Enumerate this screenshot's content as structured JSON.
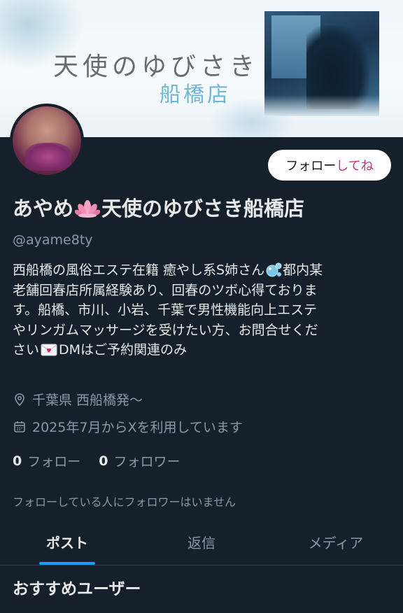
{
  "banner": {
    "title": "天使のゆびさき",
    "subtitle": "船橋店"
  },
  "follow_button": {
    "label_main": "フォロー",
    "label_accent": "してね"
  },
  "profile": {
    "name_part1": "あやめ",
    "name_emoji": "lotus-icon",
    "name_part2": "天使のゆびさき船橋店",
    "handle": "@ayame8ty",
    "bio": {
      "line1_a": "西船橋の風俗エステ在籍 癒やし系S姉さん",
      "line1_emoji": "bubbles-icon",
      "line1_b": "都内某",
      "line2": "老舗回春店所属経験あり、回春のツボ心得ておりま",
      "line3": "す。船橋、市川、小岩、千葉で男性機能向上エステ",
      "line4": "やリンガムマッサージを受けたい方、お問合せくだ",
      "line5_a": "さい",
      "line5_emoji": "love-letter-icon",
      "line5_b": "DMはご予約関連のみ"
    },
    "location": "千葉県 西船橋発〜",
    "joined": "2025年7月からXを利用しています",
    "following_count": "0",
    "following_label": "フォロー",
    "followers_count": "0",
    "followers_label": "フォロワー",
    "no_mutual_text": "フォローしている人にフォロワーはいません"
  },
  "tabs": [
    {
      "label": "ポスト",
      "active": true
    },
    {
      "label": "返信",
      "active": false
    },
    {
      "label": "メディア",
      "active": false
    }
  ],
  "recommended_title": "おすすめユーザー",
  "colors": {
    "background": "#15202b",
    "accent_blue": "#1d9bf0",
    "follow_accent": "#c13584"
  }
}
